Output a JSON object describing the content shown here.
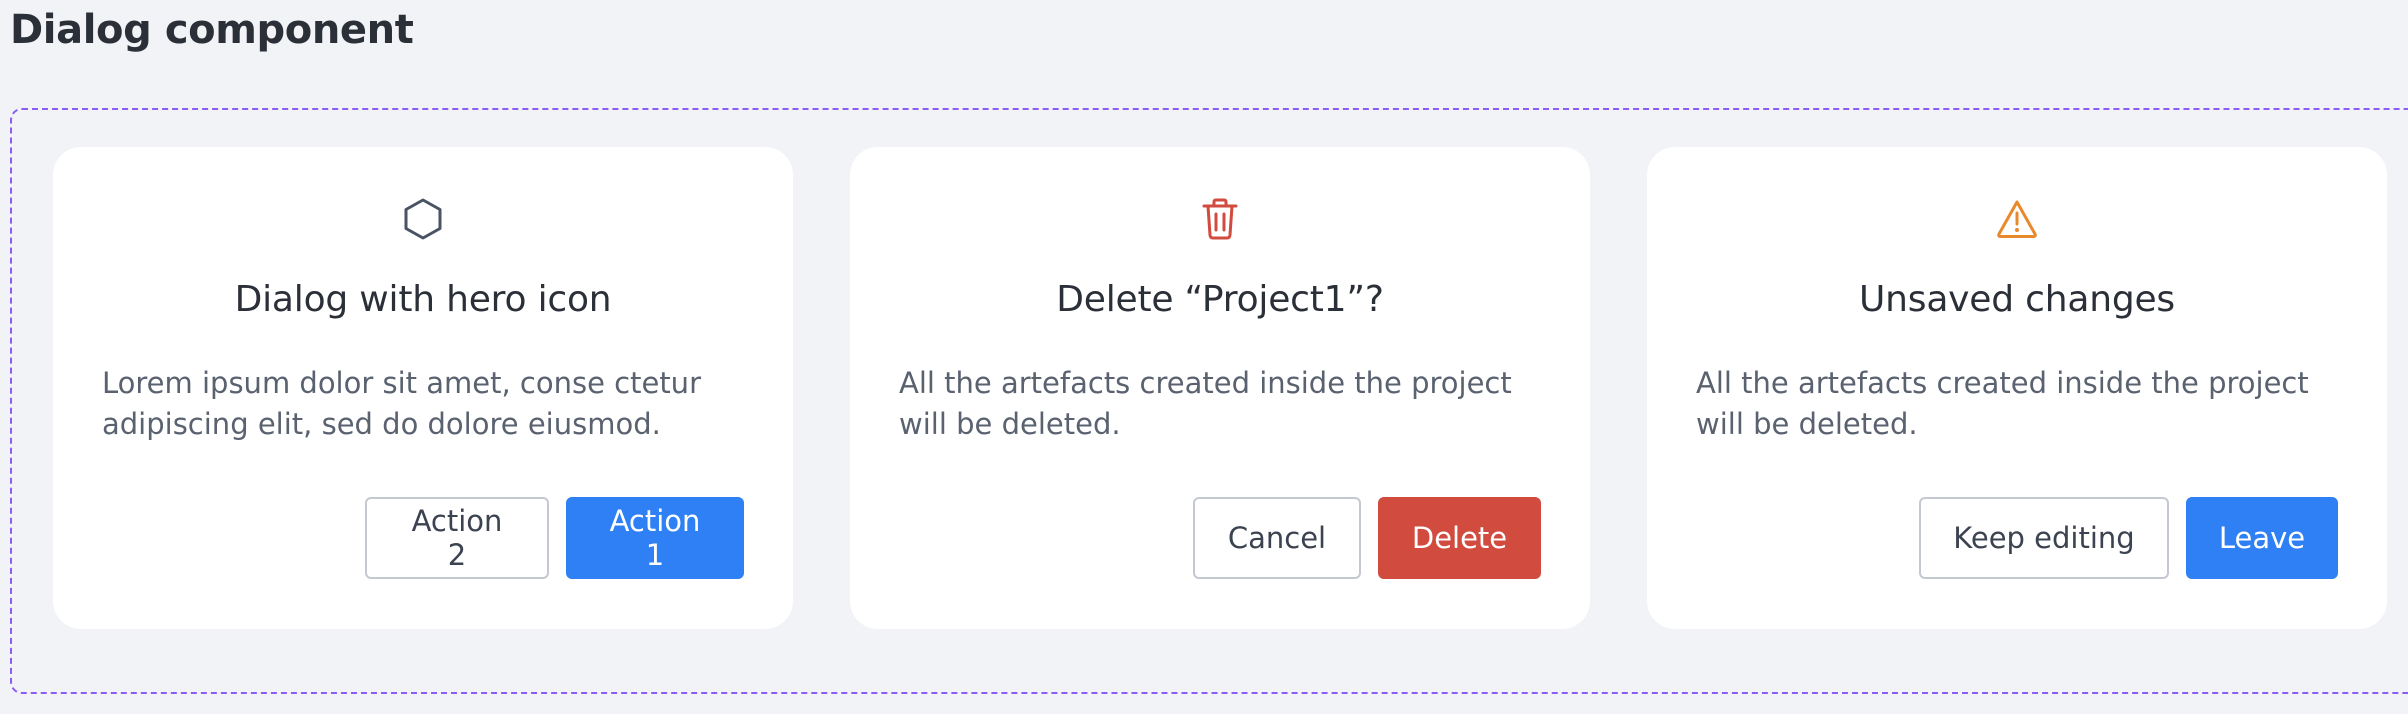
{
  "page": {
    "title": "Dialog component"
  },
  "dialogs": [
    {
      "icon": "hexagon-icon",
      "icon_color": "#4a5363",
      "title": "Dialog with hero icon",
      "body": "Lorem ipsum dolor sit amet, conse ctetur adipiscing elit, sed do dolore eiusmod.",
      "secondary_label": "Action 2",
      "primary_label": "Action 1",
      "primary_color": "#2f80f5"
    },
    {
      "icon": "trash-icon",
      "icon_color": "#d14b3f",
      "title": "Delete “Project1”?",
      "body": "All the artefacts created inside the project will be deleted.",
      "secondary_label": "Cancel",
      "primary_label": "Delete",
      "primary_color": "#d14b3f"
    },
    {
      "icon": "warning-icon",
      "icon_color": "#e8892b",
      "title": "Unsaved changes",
      "body": "All the artefacts created inside the project will be deleted.",
      "secondary_label": "Keep editing",
      "primary_label": "Leave",
      "primary_color": "#2f80f5"
    }
  ],
  "colors": {
    "background": "#f2f3f7",
    "frame_border": "#8b5cf6",
    "card_background": "#ffffff"
  }
}
